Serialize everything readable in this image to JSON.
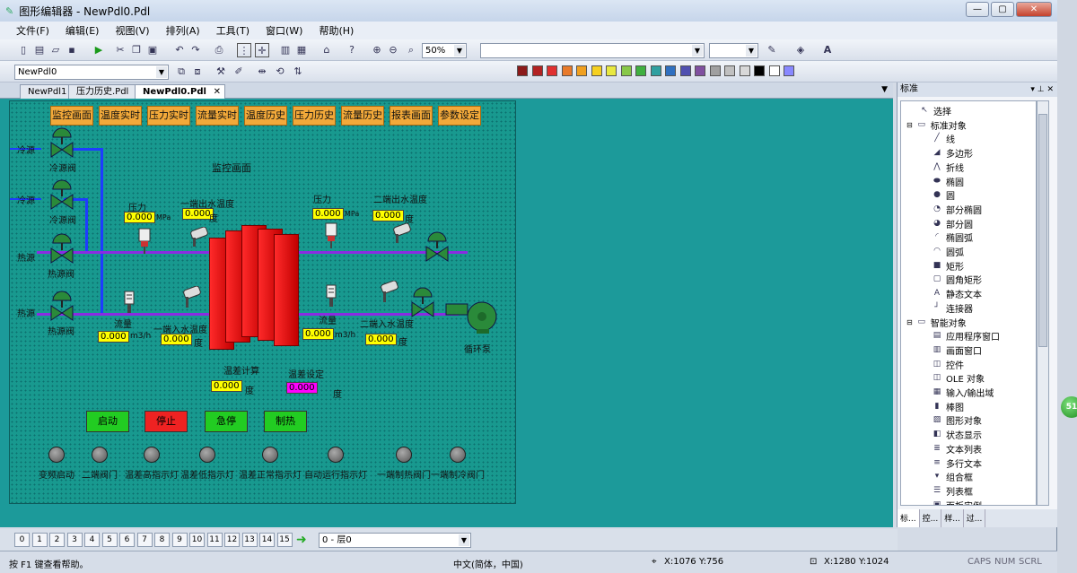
{
  "window": {
    "title": "图形编辑器 - NewPdl0.Pdl",
    "min": "—",
    "max": "▢",
    "close": "✕"
  },
  "menu": [
    "文件(F)",
    "编辑(E)",
    "视图(V)",
    "排列(A)",
    "工具(T)",
    "窗口(W)",
    "帮助(H)"
  ],
  "toolbar": {
    "zoom": "50%",
    "layer_select": "NewPdl0"
  },
  "palette": [
    "#8b1a1a",
    "#b22222",
    "#e03030",
    "#e87a2a",
    "#f0a020",
    "#f5d020",
    "#e8e840",
    "#88c848",
    "#40b040",
    "#30a0a0",
    "#3070c0",
    "#5050b0",
    "#8050a0",
    "#a0a0a0",
    "#c0c0c0",
    "#d8d8d8",
    "#000000",
    "#ffffff",
    "#8888ff"
  ],
  "tabs": [
    {
      "label": "NewPdl1",
      "active": false
    },
    {
      "label": "压力历史.Pdl",
      "active": false
    },
    {
      "label": "NewPdl0.Pdl",
      "active": true
    }
  ],
  "tab_close": "✕",
  "doc": {
    "nav": [
      "监控画面",
      "温度实时",
      "压力实时",
      "流量实时",
      "温度历史",
      "压力历史",
      "流量历史",
      "报表画面",
      "参数设定"
    ],
    "title": "监控画面",
    "labels": {
      "cold1": "冷源",
      "cold_valve1": "冷源阀",
      "cold2": "冷源",
      "cold_valve2": "冷源阀",
      "hot1": "热源",
      "hot_valve1": "热源阀",
      "hot2": "热源",
      "hot_valve2": "热源阀",
      "p1": "压力",
      "p1_unit": "MPa",
      "t1": "一端出水温度",
      "t1_unit": "度",
      "p2": "压力",
      "p2_unit": "MPa",
      "t2": "二端出水温度",
      "t2_unit": "度",
      "f1": "流量",
      "f1_unit": "m3/h",
      "t3": "一端入水温度",
      "t3_unit": "度",
      "f2": "流量",
      "f2_unit": "m3/h",
      "t4": "二端入水温度",
      "t4_unit": "度",
      "pump": "循环泵",
      "diff_calc": "温差计算",
      "diff_calc_unit": "度",
      "diff_set": "温差设定",
      "diff_set_unit": "度"
    },
    "values": {
      "p1": "0.000",
      "t1": "0.000",
      "p2": "0.000",
      "t2": "0.000",
      "f1": "0.000",
      "t3": "0.000",
      "f2": "0.000",
      "t4": "0.000",
      "diff_calc": "0.000",
      "diff_set": "0.000"
    },
    "controls": [
      {
        "label": "启动",
        "color": "#22cc22"
      },
      {
        "label": "停止",
        "color": "#ee2222"
      },
      {
        "label": "急停",
        "color": "#22cc22"
      },
      {
        "label": "制热",
        "color": "#22cc22"
      }
    ],
    "lamps": [
      "变频启动",
      "二端阀门",
      "温差高指示灯",
      "温差低指示灯",
      "温差正常指示灯",
      "自动运行指示灯",
      "一端制热阀门",
      "一端制冷阀门"
    ]
  },
  "rpanel": {
    "title": "标准",
    "items": [
      {
        "label": "选择",
        "icon": "cursor-icon",
        "glyph": "↖"
      },
      {
        "label": "标准对象",
        "icon": "folder-icon",
        "glyph": "▭"
      },
      {
        "label": "线",
        "icon": "line-icon",
        "glyph": "╱"
      },
      {
        "label": "多边形",
        "icon": "polygon-icon",
        "glyph": "◢"
      },
      {
        "label": "折线",
        "icon": "polyline-icon",
        "glyph": "⋀"
      },
      {
        "label": "椭圆",
        "icon": "ellipse-icon",
        "glyph": "⬬"
      },
      {
        "label": "圆",
        "icon": "circle-icon",
        "glyph": "●"
      },
      {
        "label": "部分椭圆",
        "icon": "partial-ellipse-icon",
        "glyph": "◔"
      },
      {
        "label": "部分圆",
        "icon": "partial-circle-icon",
        "glyph": "◕"
      },
      {
        "label": "椭圆弧",
        "icon": "elliptic-arc-icon",
        "glyph": "◜"
      },
      {
        "label": "圆弧",
        "icon": "arc-icon",
        "glyph": "◠"
      },
      {
        "label": "矩形",
        "icon": "rectangle-icon",
        "glyph": "■"
      },
      {
        "label": "圆角矩形",
        "icon": "rounded-rectangle-icon",
        "glyph": "▢"
      },
      {
        "label": "静态文本",
        "icon": "text-icon",
        "glyph": "A"
      },
      {
        "label": "连接器",
        "icon": "connector-icon",
        "glyph": "┘"
      },
      {
        "label": "智能对象",
        "icon": "folder-icon",
        "glyph": "▭"
      },
      {
        "label": "应用程序窗口",
        "icon": "app-window-icon",
        "glyph": "▤"
      },
      {
        "label": "画面窗口",
        "icon": "picture-window-icon",
        "glyph": "▥"
      },
      {
        "label": "控件",
        "icon": "ocx-icon",
        "glyph": "◫"
      },
      {
        "label": "OLE 对象",
        "icon": "ole-icon",
        "glyph": "◫"
      },
      {
        "label": "输入/输出域",
        "icon": "io-field-icon",
        "glyph": "▦"
      },
      {
        "label": "棒图",
        "icon": "bar-graph-icon",
        "glyph": "▮"
      },
      {
        "label": "图形对象",
        "icon": "graphic-object-icon",
        "glyph": "▨"
      },
      {
        "label": "状态显示",
        "icon": "status-display-icon",
        "glyph": "◧"
      },
      {
        "label": "文本列表",
        "icon": "text-list-icon",
        "glyph": "≣"
      },
      {
        "label": "多行文本",
        "icon": "multiline-text-icon",
        "glyph": "≡"
      },
      {
        "label": "组合框",
        "icon": "combobox-icon",
        "glyph": "▾"
      },
      {
        "label": "列表框",
        "icon": "listbox-icon",
        "glyph": "☰"
      },
      {
        "label": "面板实例",
        "icon": "panel-icon",
        "glyph": "▣"
      }
    ],
    "tabs": [
      "标...",
      "控...",
      "样...",
      "过..."
    ]
  },
  "pages": [
    "0",
    "1",
    "2",
    "3",
    "4",
    "5",
    "6",
    "7",
    "8",
    "9",
    "10",
    "11",
    "12",
    "13",
    "14",
    "15"
  ],
  "layer": "0 - 层0",
  "status": {
    "help": "按 F1 键查看帮助。",
    "ime": "中文(简体，中国)",
    "mouse": "X:1076 Y:756",
    "size": "X:1280 Y:1024",
    "caps": "CAPS",
    "num": "NUM",
    "scrl": "SCRL"
  },
  "side_badge": "51"
}
